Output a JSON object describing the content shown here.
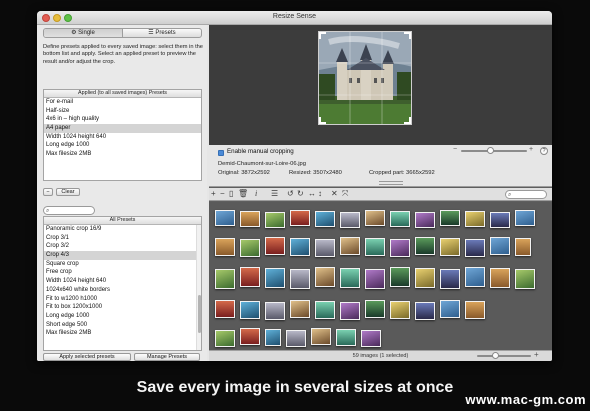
{
  "window": {
    "title": "Resize Sense"
  },
  "left_panel": {
    "tabs": [
      "Single",
      "Presets"
    ],
    "description": "Define presets applied to every saved image: select them in the bottom list and apply.  Select an applied preset to preview the result and/or adjust the crop.",
    "applied": {
      "header": "Applied (to all saved images) Presets",
      "items": [
        "For e-mail",
        "Half-size",
        "4x6 in – high quality",
        "A4 paper",
        "Width 1024 height 640",
        "Long edge 1000",
        "Max filesize 2MB"
      ],
      "selected_index": 3
    },
    "remove_button": "−",
    "clear_button": "Clear",
    "all": {
      "header": "All Presets",
      "items": [
        "Panoramic crop 16/9",
        "Crop 3/1",
        "Crop 3/2",
        "Crop 4/3",
        "Square crop",
        "Free crop",
        "Width 1024 height 640",
        "1024x640 white borders",
        "Fit to w1200 h1000",
        "Fit to box 1200x1000",
        "Long edge 1000",
        "Short edge 500",
        "Max filesize 2MB"
      ],
      "selected_index": 3
    },
    "apply_button": "Apply selected presets",
    "manage_button": "Manage Presets"
  },
  "details": {
    "manual_crop_label": "Enable manual cropping",
    "manual_crop_checked": true,
    "filename": "Demid-Chaumont-sur-Loire-06.jpg",
    "original": "Original: 3872x2592",
    "resized": "Resized: 3507x2480",
    "cropped": "Cropped part: 3665x2592",
    "zoom_level": 0.45,
    "help_label": "?",
    "minus_label": "−",
    "plus_label": "+"
  },
  "toolbar": {
    "icons": [
      "add-icon",
      "remove-icon",
      "document-icon",
      "trash-icon",
      "info-icon",
      "list-icon",
      "rotate-left-icon",
      "rotate-right-icon",
      "flip-horizontal-icon",
      "flip-vertical-icon",
      "close-x-icon",
      "expand-icon"
    ]
  },
  "browser": {
    "status": "59 images (1 selected)",
    "thumb_size_level": 0.35
  },
  "tagline": "Save every image in several sizes at once",
  "watermark": "www.mac-gm.com"
}
